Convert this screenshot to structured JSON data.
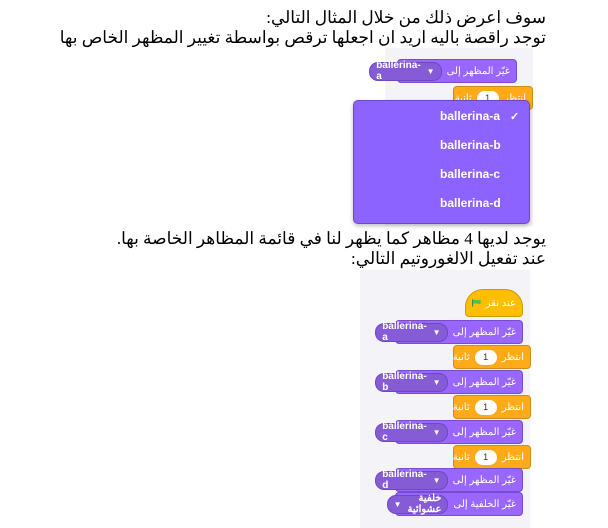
{
  "text": {
    "line1": "سوف اعرض ذلك من خلال المثال التالي:",
    "line2": "توجد راقصة باليه اريد ان اجعلها ترقص بواسطة تغيير المظهر الخاص بها",
    "line3": "يوجد لديها 4 مظاهر كما يظهر لنا في قائمة المظاهر الخاصة بها.",
    "line4": "عند تفعيل الالغوروتيم التالي:"
  },
  "example1": {
    "switch_label": "غيّر المظهر إلى",
    "selected_costume": "ballerina-a",
    "wait_label": "انتظر",
    "wait_value": "1",
    "wait_unit": "ثانية",
    "menu": {
      "items": [
        "ballerina-a",
        "ballerina-b",
        "ballerina-c",
        "ballerina-d"
      ],
      "checked": "ballerina-a",
      "check_glyph": "✓"
    }
  },
  "script": {
    "hat_label": "عند نقر",
    "switch_label": "غيّر المظهر إلى",
    "wait_label": "انتظر",
    "wait_unit": "ثانية",
    "costumes": [
      "ballerina-a",
      "ballerina-b",
      "ballerina-c",
      "ballerina-d"
    ],
    "waits": [
      "1",
      "1",
      "1"
    ],
    "backdrop_label": "غيّر الخلفية إلى",
    "backdrop_value": "خلفية عشوائية"
  },
  "icons": {
    "flag": "green-flag-icon",
    "caret": "dropdown-caret-icon",
    "check": "checkmark-icon"
  },
  "colors": {
    "looks": "#9966ff",
    "control": "#ffab19",
    "events": "#ffbf00",
    "menu": "#8d63ff",
    "flag": "#4cbf56"
  }
}
